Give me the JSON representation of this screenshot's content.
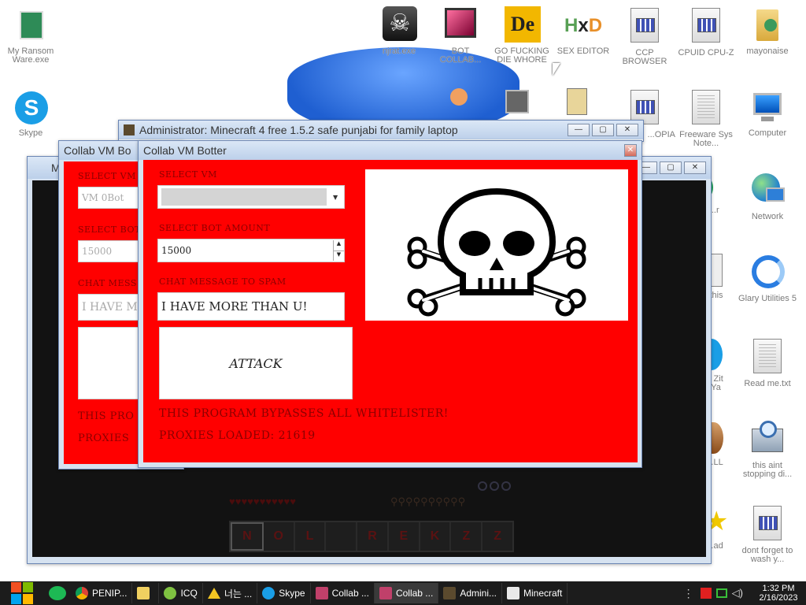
{
  "desktop": {
    "icons": [
      {
        "label": "My Ransom Ware.exe"
      },
      {
        "label": "Skype"
      },
      {
        "label": "njrat.exe"
      },
      {
        "label": "BOT COLLAB..."
      },
      {
        "label": "GO FUCKING DIE WHORE"
      },
      {
        "label": "SEX EDITOR"
      },
      {
        "label": "CCP BROWSER"
      },
      {
        "label": "CPUID CPU-Z"
      },
      {
        "label": "mayonaise"
      },
      {
        "label": "...OPIA"
      },
      {
        "label": "Freeware Sys Note..."
      },
      {
        "label": "Computer"
      },
      {
        "label": "...ad ...r"
      },
      {
        "label": "Network"
      },
      {
        "label": "this"
      },
      {
        "label": "Glary Utilities 5"
      },
      {
        "label": "...t Zit ...Ya"
      },
      {
        "label": "Read me.txt"
      },
      {
        "label": "...LL"
      },
      {
        "label": "this aint stopping di..."
      },
      {
        "label": "...ad"
      },
      {
        "label": "dont forget to wash y..."
      }
    ]
  },
  "minecraft_window": {
    "title": "Administrator:  Minecraft 4 free 1.5.2 safe punjabi for family laptop",
    "inner_title": "M"
  },
  "back_window": {
    "title": "Collab VM Bo",
    "select_vm_label": "SELECT VM",
    "vm_value": "VM 0Bot",
    "select_bot_label": "SELECT BOT",
    "bot_value": "15000",
    "chat_label": "CHAT MESS",
    "chat_value": "I HAVE M",
    "footer1": "THIS PRO",
    "footer2": "PROXIES"
  },
  "front_window": {
    "title": "Collab VM Botter",
    "select_vm_label": "SELECT VM",
    "select_bot_label": "SELECT BOT AMOUNT",
    "bot_amount": "15000",
    "chat_label": "CHAT MESSAGE TO SPAM",
    "chat_value": "I HAVE MORE THAN U!",
    "attack_label": "ATTACK",
    "footer1": "THIS PROGRAM BYPASSES ALL WHITELISTER!",
    "footer2": "PROXIES LOADED: 21619",
    "image_icon": "skull-crossbones-icon"
  },
  "hotbar": {
    "letters": [
      "N",
      "O",
      "L",
      "R",
      "E",
      "K",
      "Z",
      "Z"
    ]
  },
  "taskbar": {
    "items": [
      {
        "label": "PENIP..."
      },
      {
        "label": ""
      },
      {
        "label": "ICQ"
      },
      {
        "label": "너는 ..."
      },
      {
        "label": "Skype"
      },
      {
        "label": "Collab ..."
      },
      {
        "label": "Collab ..."
      },
      {
        "label": "Admini..."
      },
      {
        "label": "Minecraft"
      }
    ],
    "time": "1:32 PM",
    "date": "2/16/2023"
  },
  "colors": {
    "accent_red": "#ff0000",
    "title_bar": "#c9daf0"
  }
}
